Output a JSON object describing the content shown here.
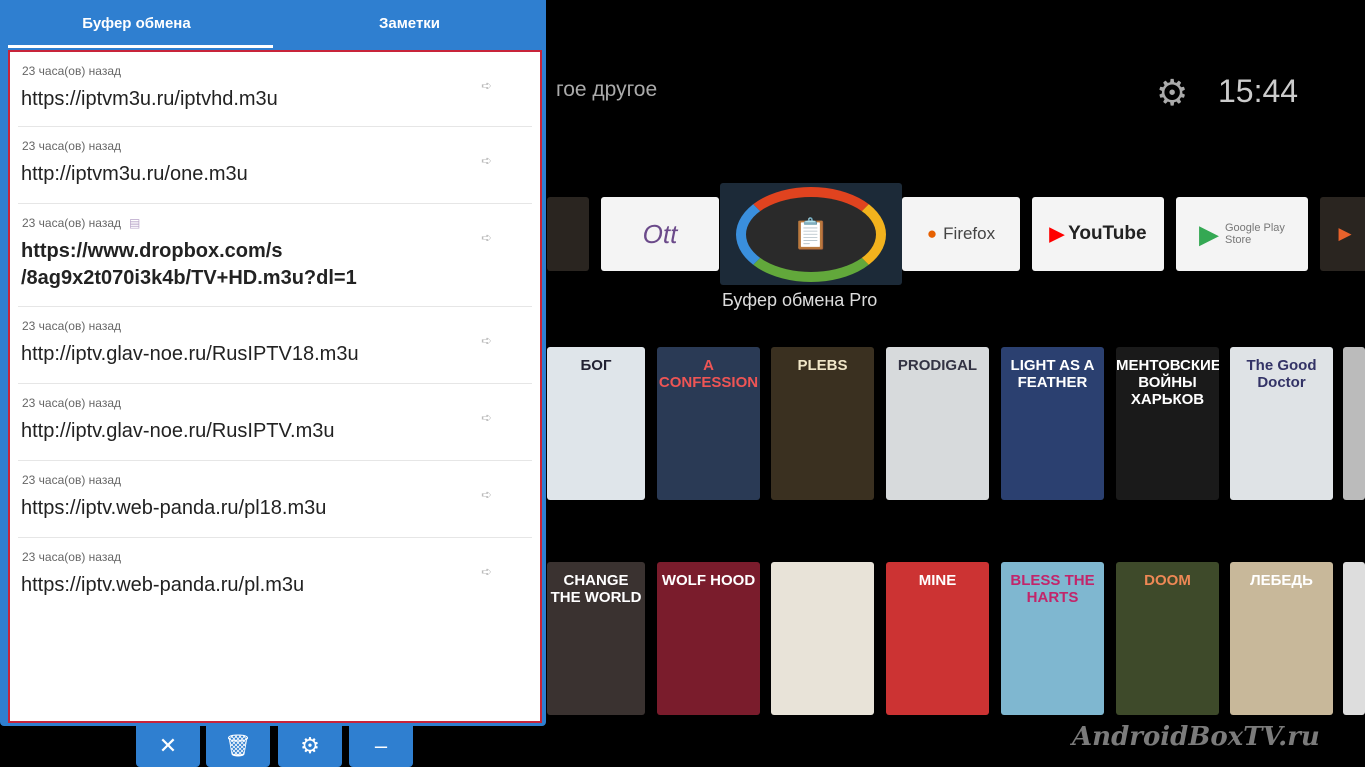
{
  "clipboard_panel": {
    "tabs": [
      {
        "label": "Буфер обмена",
        "active": true
      },
      {
        "label": "Заметки",
        "active": false
      }
    ],
    "items": [
      {
        "time": "23 часа(ов) назад",
        "url": "https://iptvm3u.ru/iptvhd.m3u"
      },
      {
        "time": "23 часа(ов) назад",
        "url": "http://iptvm3u.ru/one.m3u"
      },
      {
        "time": "23 часа(ов) назад",
        "url": "https://www.dropbox.com/s\n/8ag9x2t070i3k4b/TV+HD.m3u?dl=1",
        "current": true
      },
      {
        "time": "23 часа(ов) назад",
        "url": "http://iptv.glav-noe.ru/RusIPTV18.m3u"
      },
      {
        "time": "23 часа(ов) назад",
        "url": "http://iptv.glav-noe.ru/RusIPTV.m3u"
      },
      {
        "time": "23 часа(ов) назад",
        "url": "https://iptv.web-panda.ru/pl18.m3u"
      },
      {
        "time": "23 часа(ов) назад",
        "url": "https://iptv.web-panda.ru/pl.m3u"
      }
    ],
    "buttons": [
      "close-icon",
      "trash-icon",
      "gear-icon",
      "minimize-icon"
    ],
    "accent": "#2f7fd0",
    "border": "#c8243a"
  },
  "tv": {
    "search_hint": "гое другое",
    "clock": "15:44",
    "apps": [
      "Firefox",
      "YouTube",
      "Google Play Store"
    ],
    "focused_app": "Буфер обмена Pro",
    "posters_row1": [
      "БОГ",
      "A CONFESSION",
      "PLEBS",
      "PRODIGAL",
      "LIGHT AS A FEATHER",
      "МЕНТОВСКИЕ ВОЙНЫ ХАРЬКОВ",
      "The Good Doctor"
    ],
    "posters_row2": [
      "CHANGE THE WORLD",
      "WOLF HOOD",
      "",
      "MINE",
      "BLESS THE HARTS",
      "DOOM",
      "ЛЕБЕДЬ"
    ]
  },
  "watermark": "AndroidBoxTV.ru"
}
